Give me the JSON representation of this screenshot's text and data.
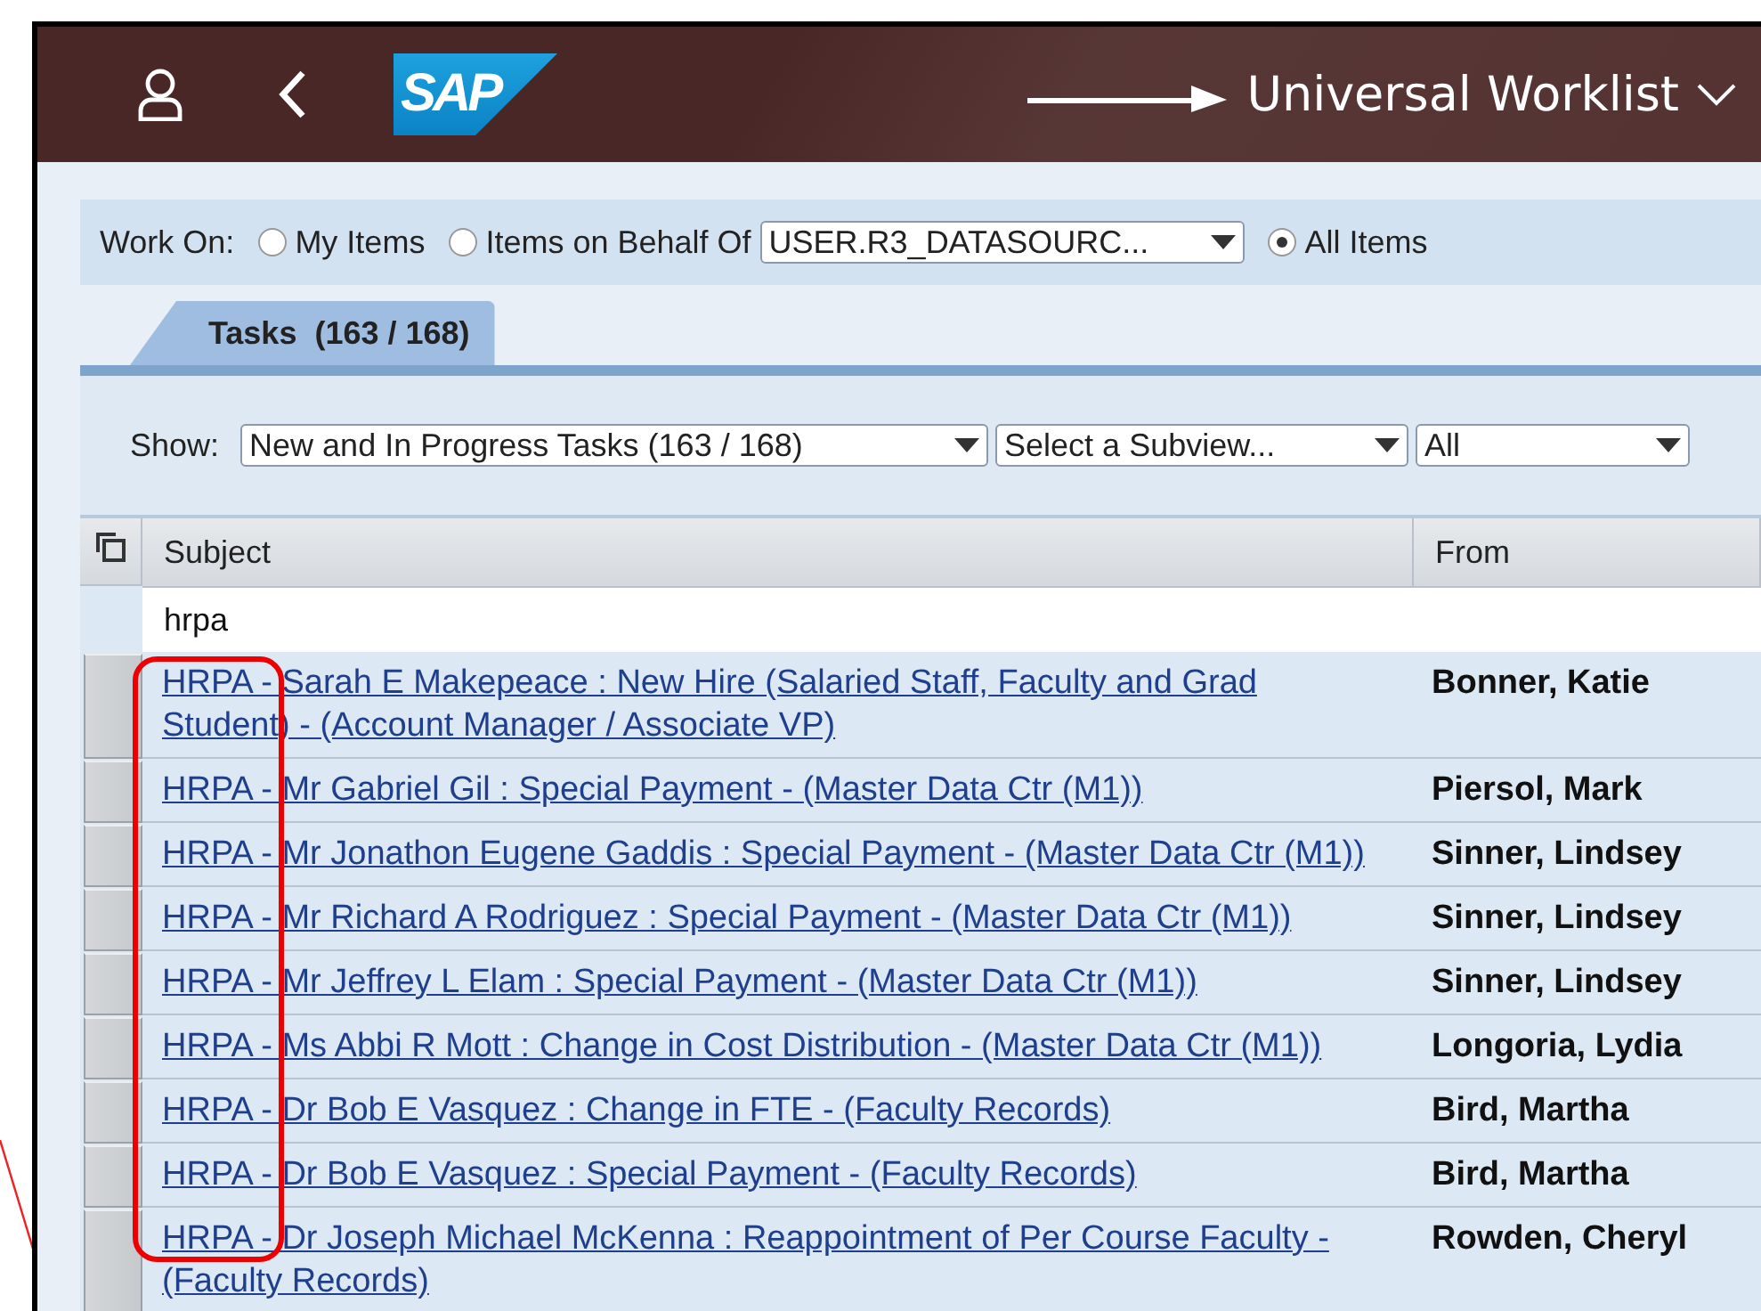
{
  "header": {
    "logo": "SAP",
    "title": "Universal Worklist"
  },
  "work_on": {
    "label": "Work On:",
    "options": [
      {
        "label": "My Items",
        "selected": false
      },
      {
        "label": "Items on Behalf Of",
        "selected": false,
        "dropdown": "USER.R3_DATASOURC..."
      },
      {
        "label": "All Items",
        "selected": true
      }
    ]
  },
  "tabs": [
    {
      "label": "Tasks  (163 / 168)",
      "selected": true
    }
  ],
  "show": {
    "label": "Show:",
    "dropdowns": [
      "New and In Progress Tasks  (163 / 168)",
      "Select a Subview...",
      "All"
    ]
  },
  "table": {
    "columns": [
      "Subject",
      "From"
    ],
    "filter": "hrpa",
    "rows": [
      {
        "subject": "HRPA - Sarah E Makepeace : New Hire (Salaried Staff, Faculty and Grad Student) - (Account Manager / Associate VP)",
        "from": "Bonner, Katie"
      },
      {
        "subject": "HRPA - Mr Gabriel Gil : Special Payment - (Master Data Ctr (M1))",
        "from": "Piersol, Mark"
      },
      {
        "subject": "HRPA - Mr Jonathon Eugene Gaddis : Special Payment - (Master Data Ctr (M1))",
        "from": "Sinner, Lindsey"
      },
      {
        "subject": "HRPA - Mr Richard A Rodriguez : Special Payment - (Master Data Ctr (M1))",
        "from": "Sinner, Lindsey"
      },
      {
        "subject": "HRPA - Mr Jeffrey L Elam : Special Payment - (Master Data Ctr (M1))",
        "from": "Sinner, Lindsey"
      },
      {
        "subject": "HRPA - Ms Abbi R Mott : Change in Cost Distribution - (Master Data Ctr (M1))",
        "from": "Longoria, Lydia"
      },
      {
        "subject": "HRPA - Dr Bob E Vasquez : Change in FTE - (Faculty Records)",
        "from": "Bird, Martha"
      },
      {
        "subject": "HRPA - Dr Bob E Vasquez : Special Payment - (Faculty Records)",
        "from": "Bird, Martha"
      },
      {
        "subject": "HRPA - Dr Joseph Michael McKenna : Reappointment of Per Course Faculty - (Faculty Records)",
        "from": "Rowden, Cheryl"
      }
    ]
  }
}
